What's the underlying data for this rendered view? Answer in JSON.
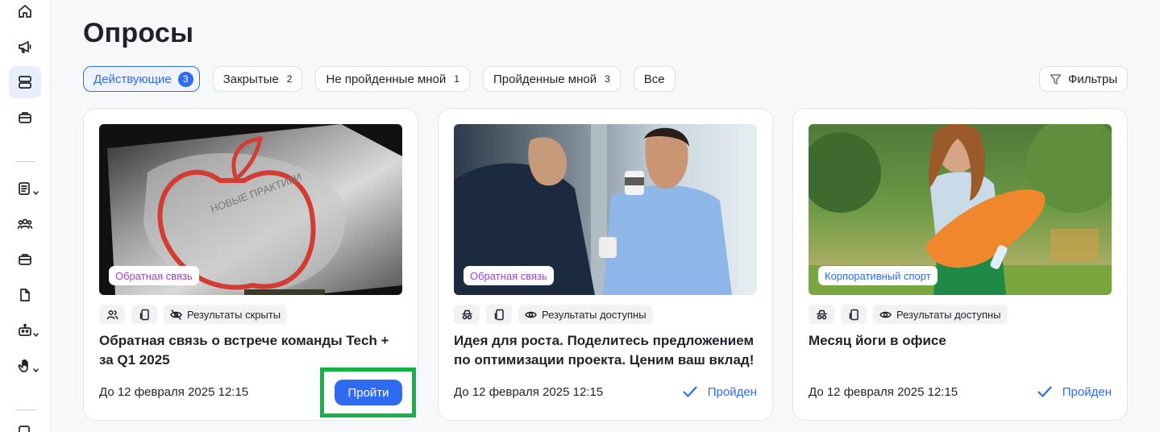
{
  "page": {
    "title": "Опросы"
  },
  "sidebar": {
    "items": [
      {
        "icon": "home-icon"
      },
      {
        "icon": "megaphone-icon"
      },
      {
        "icon": "polls-icon",
        "active": true
      },
      {
        "icon": "briefcase-icon"
      },
      {
        "icon": "document-list-icon"
      },
      {
        "icon": "people-icon"
      },
      {
        "icon": "briefcase-icon"
      },
      {
        "icon": "file-icon"
      },
      {
        "icon": "robot-icon"
      },
      {
        "icon": "hand-icon"
      }
    ]
  },
  "tabs": [
    {
      "label": "Действующие",
      "count": "3",
      "active": true
    },
    {
      "label": "Закрытые",
      "count": "2"
    },
    {
      "label": "Не пройденные мной",
      "count": "1"
    },
    {
      "label": "Пройденные мной",
      "count": "3"
    },
    {
      "label": "Все"
    }
  ],
  "filters": {
    "label": "Фильтры"
  },
  "cards": [
    {
      "category": "Обратная связь",
      "results": "Результаты скрыты",
      "title": "Обратная связь о встрече команды Tech + за Q1 2025",
      "deadline": "До 12 февраля 2025 12:15",
      "action": "Пройти"
    },
    {
      "category": "Обратная связь",
      "results": "Результаты доступны",
      "title": "Идея для роста. Поделитесь предложением по оптимизации проекта. Ценим ваш вклад!",
      "deadline": "До 12 февраля 2025 12:15",
      "status": "Пройден"
    },
    {
      "category": "Корпоративный спорт",
      "results": "Результаты доступны",
      "title": "Месяц йоги в офисе",
      "deadline": "До 12 февраля 2025 12:15",
      "status": "Пройден"
    }
  ],
  "colors": {
    "accent": "#2f6bf0",
    "highlight": "#12b347",
    "category_purple": "#a33fd1"
  }
}
